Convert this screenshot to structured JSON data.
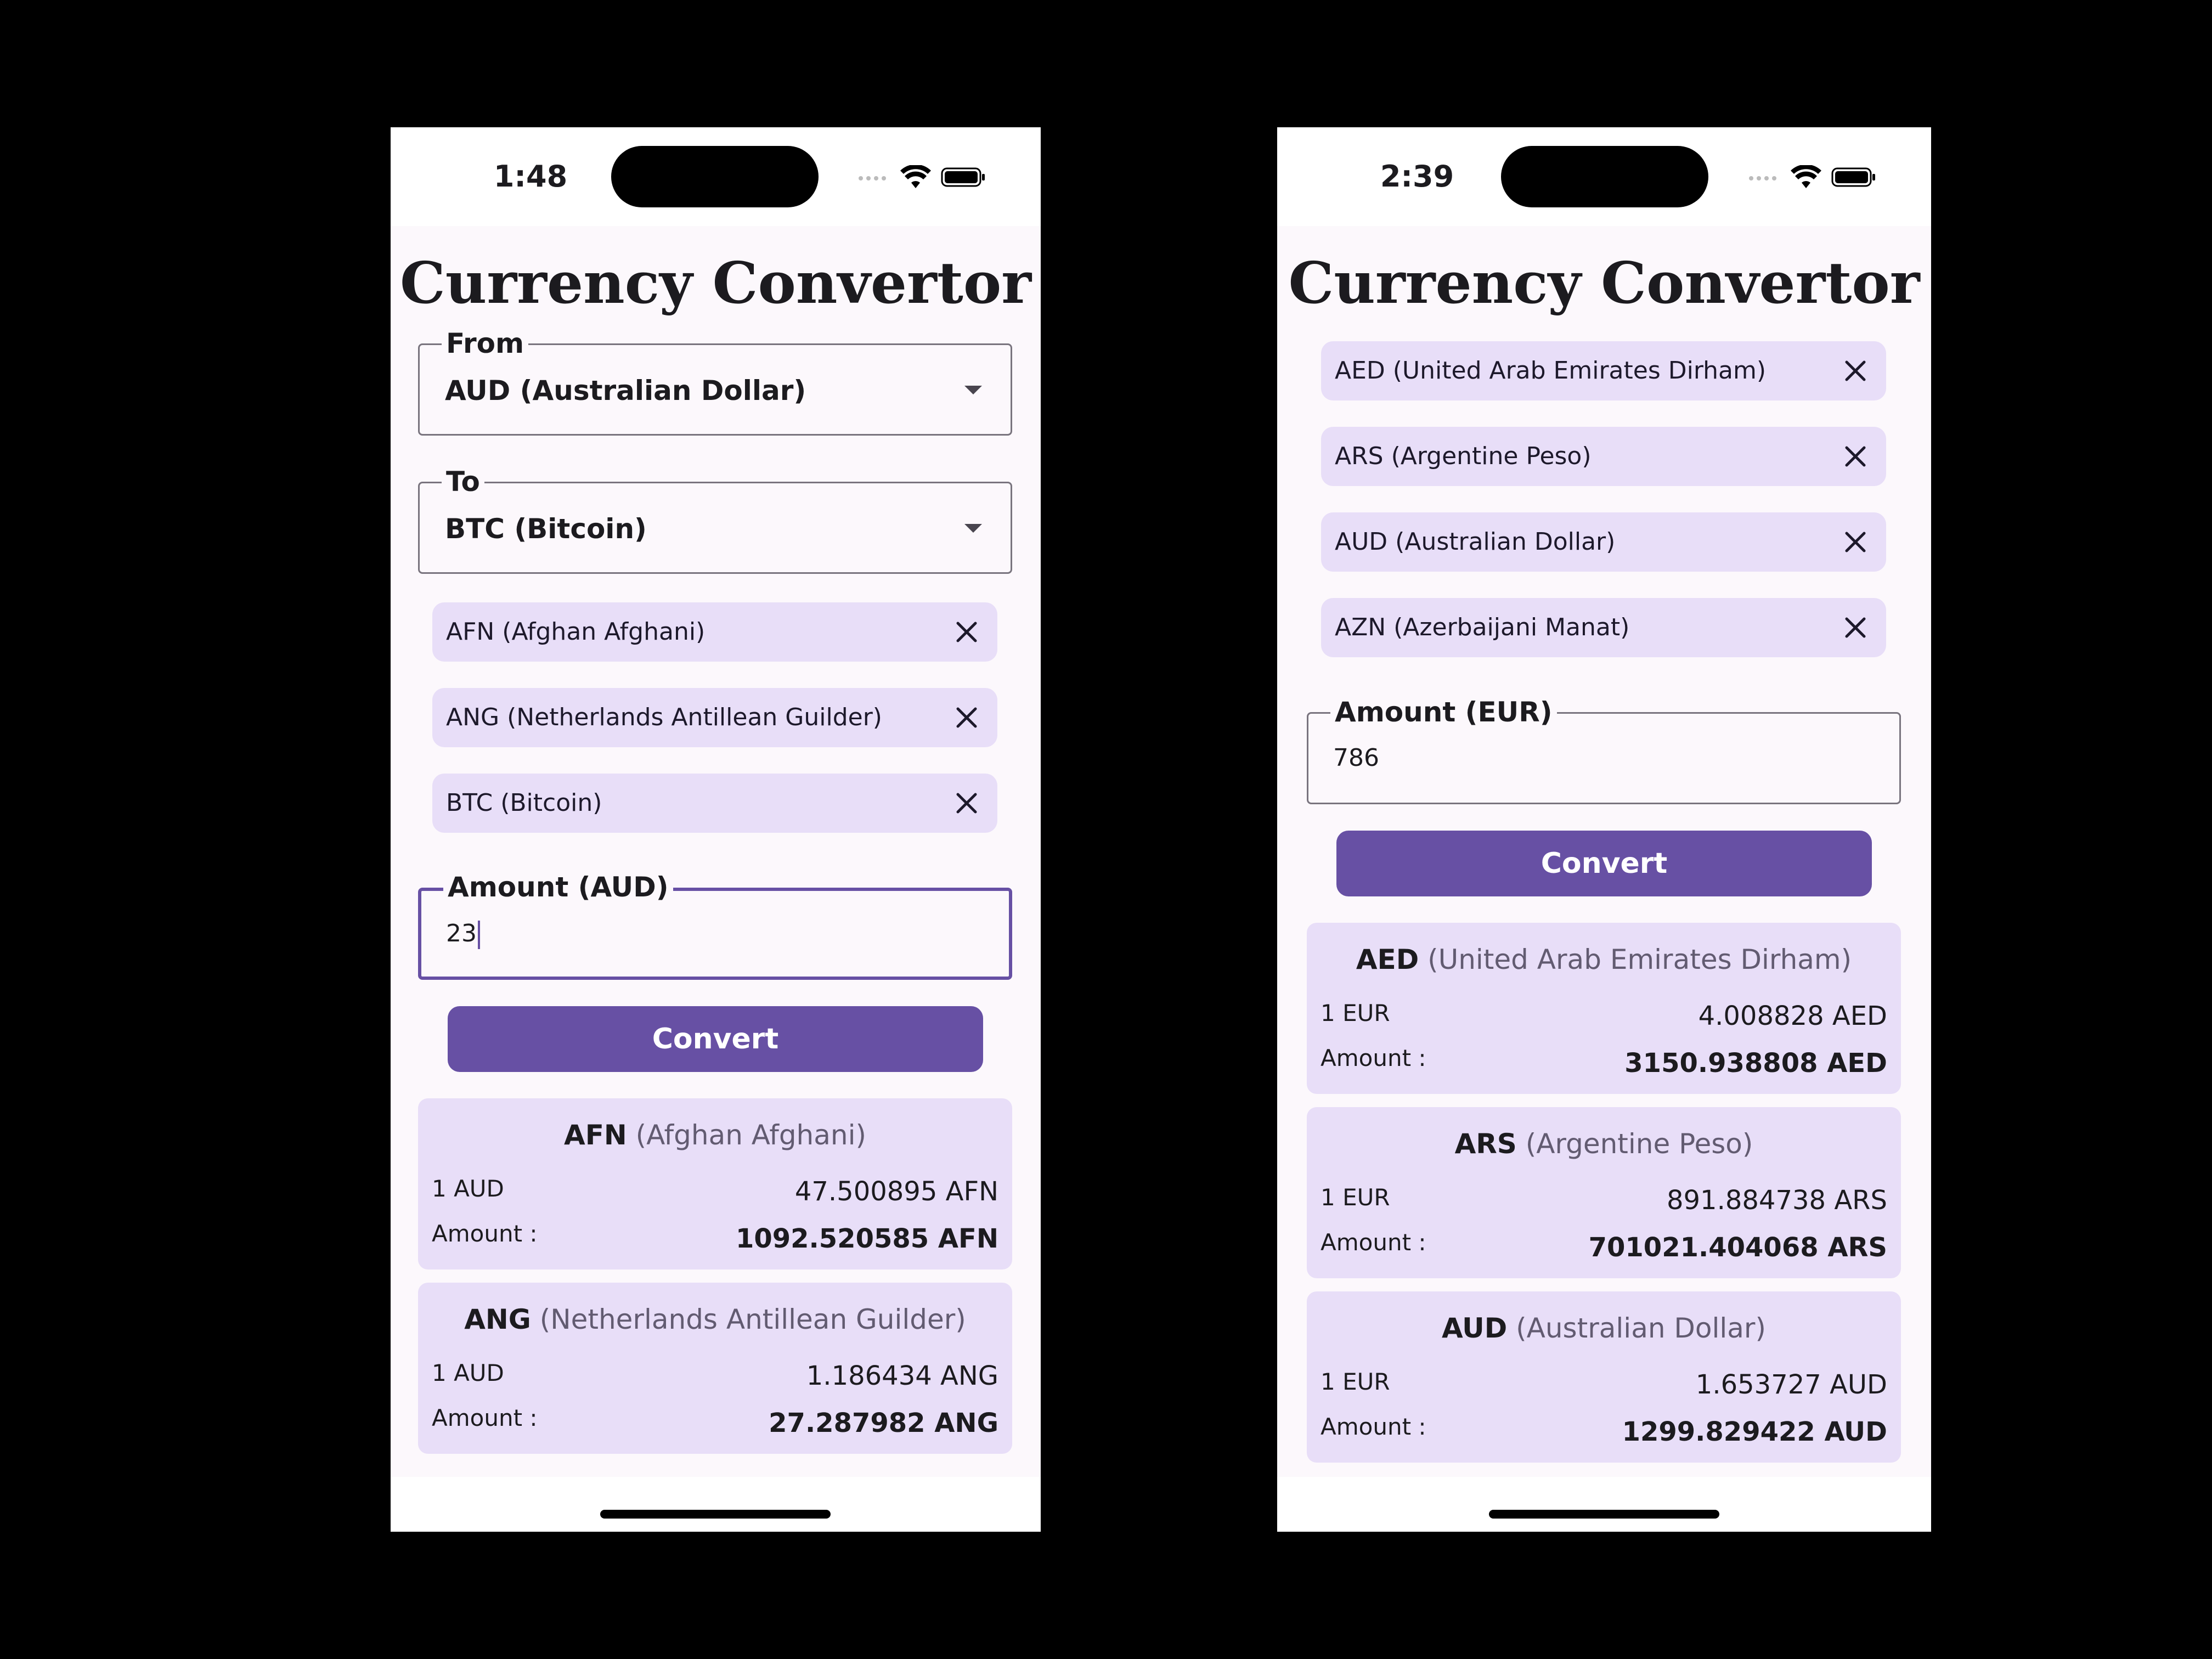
{
  "phones": [
    {
      "status": {
        "time": "1:48"
      },
      "title": "Currency Convertor",
      "from": {
        "label": "From",
        "value": "AUD (Australian Dollar)"
      },
      "to": {
        "label": "To",
        "value": "BTC (Bitcoin)"
      },
      "chips": [
        {
          "label": "AFN (Afghan Afghani)"
        },
        {
          "label": "ANG (Netherlands Antillean Guilder)"
        },
        {
          "label": "BTC (Bitcoin)"
        }
      ],
      "amount": {
        "label": "Amount (AUD)",
        "value": "23"
      },
      "convert_label": "Convert",
      "results": [
        {
          "code": "AFN",
          "name": "(Afghan Afghani)",
          "rate_label": "1 AUD",
          "rate_value": "47.500895 AFN",
          "amount_label": "Amount :",
          "amount_value": "1092.520585 AFN"
        },
        {
          "code": "ANG",
          "name": "(Netherlands Antillean Guilder)",
          "rate_label": "1 AUD",
          "rate_value": "1.186434 ANG",
          "amount_label": "Amount :",
          "amount_value": "27.287982 ANG"
        }
      ]
    },
    {
      "status": {
        "time": "2:39"
      },
      "title": "Currency Convertor",
      "chips": [
        {
          "label": "AED (United Arab Emirates Dirham)"
        },
        {
          "label": "ARS (Argentine Peso)"
        },
        {
          "label": "AUD (Australian Dollar)"
        },
        {
          "label": "AZN (Azerbaijani Manat)"
        }
      ],
      "amount": {
        "label": "Amount (EUR)",
        "value": "786"
      },
      "convert_label": "Convert",
      "results": [
        {
          "code": "AED",
          "name": "(United Arab Emirates Dirham)",
          "rate_label": "1 EUR",
          "rate_value": "4.008828 AED",
          "amount_label": "Amount :",
          "amount_value": "3150.938808 AED"
        },
        {
          "code": "ARS",
          "name": "(Argentine Peso)",
          "rate_label": "1 EUR",
          "rate_value": "891.884738 ARS",
          "amount_label": "Amount :",
          "amount_value": "701021.404068 ARS"
        },
        {
          "code": "AUD",
          "name": "(Australian Dollar)",
          "rate_label": "1 EUR",
          "rate_value": "1.653727 AUD",
          "amount_label": "Amount :",
          "amount_value": "1299.829422 AUD"
        }
      ]
    }
  ],
  "colors": {
    "primary": "#6750a4",
    "chip_bg": "#e8def8",
    "surface": "#fcf8fc"
  },
  "icons": {
    "close": "close-icon",
    "dropdown": "dropdown-arrow-icon",
    "wifi": "wifi-icon",
    "battery": "battery-icon",
    "signal": "signal-icon"
  }
}
